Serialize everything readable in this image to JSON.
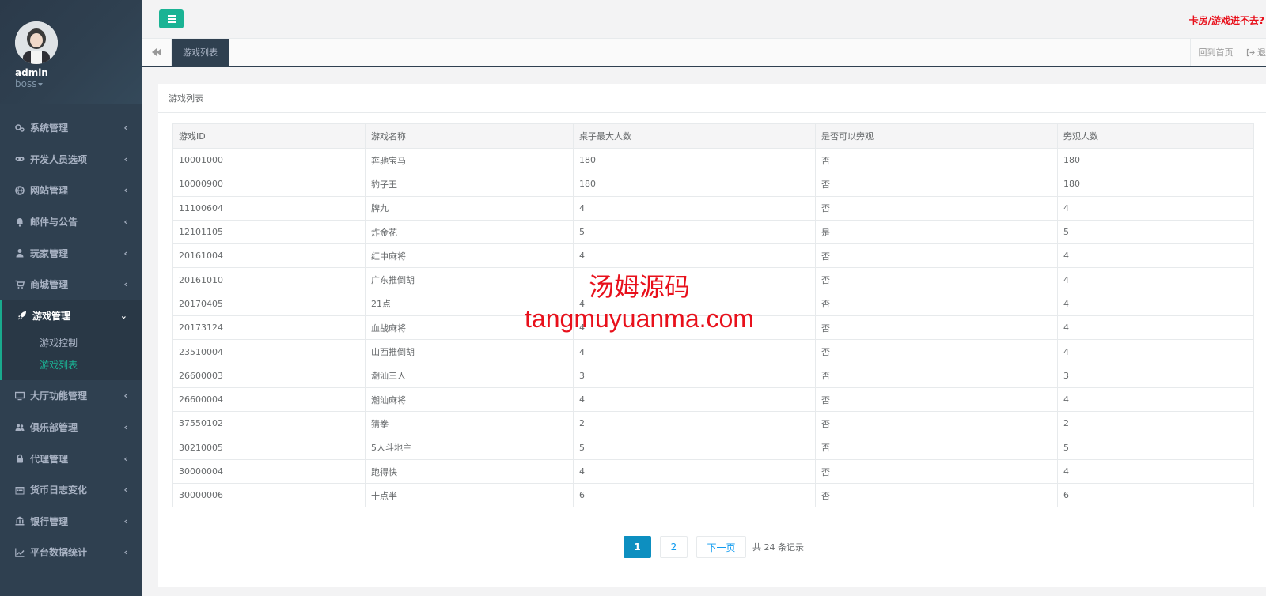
{
  "colors": {
    "sidebar_bg": "#2f4050",
    "accent": "#1ab394",
    "alert": "#e8101b",
    "page_active": "#0d8fc0"
  },
  "profile": {
    "name": "admin",
    "role": "boss"
  },
  "topbar": {
    "alert_text": "卡房/游戏进不去?"
  },
  "sidebar": {
    "items": [
      {
        "label": "系统管理",
        "icon": "cogs-icon"
      },
      {
        "label": "开发人员选项",
        "icon": "gamepad-icon"
      },
      {
        "label": "网站管理",
        "icon": "globe-icon"
      },
      {
        "label": "邮件与公告",
        "icon": "bell-icon"
      },
      {
        "label": "玩家管理",
        "icon": "user-icon"
      },
      {
        "label": "商城管理",
        "icon": "cart-icon"
      }
    ],
    "active_group": {
      "label": "游戏管理",
      "icon": "rocket-icon",
      "children": [
        {
          "label": "游戏控制"
        },
        {
          "label": "游戏列表"
        }
      ]
    },
    "items_after": [
      {
        "label": "大厅功能管理",
        "icon": "desktop-icon"
      },
      {
        "label": "俱乐部管理",
        "icon": "users-icon"
      },
      {
        "label": "代理管理",
        "icon": "lock-icon"
      },
      {
        "label": "货币日志变化",
        "icon": "calendar-icon"
      },
      {
        "label": "银行管理",
        "icon": "bank-icon"
      },
      {
        "label": "平台数据统计",
        "icon": "line-chart-icon"
      }
    ]
  },
  "tabs": {
    "active": "游戏列表",
    "home": "回到首页",
    "exit": "退出"
  },
  "panel": {
    "title": "游戏列表"
  },
  "table": {
    "headers": [
      "游戏ID",
      "游戏名称",
      "桌子最大人数",
      "是否可以旁观",
      "旁观人数"
    ],
    "rows": [
      [
        "10001000",
        "奔驰宝马",
        "180",
        "否",
        "180"
      ],
      [
        "10000900",
        "豹子王",
        "180",
        "否",
        "180"
      ],
      [
        "11100604",
        "牌九",
        "4",
        "否",
        "4"
      ],
      [
        "12101105",
        "炸金花",
        "5",
        "是",
        "5"
      ],
      [
        "20161004",
        "红中麻将",
        "4",
        "否",
        "4"
      ],
      [
        "20161010",
        "广东推倒胡",
        "",
        "否",
        "4"
      ],
      [
        "20170405",
        "21点",
        "4",
        "否",
        "4"
      ],
      [
        "20173124",
        "血战麻将",
        "4",
        "否",
        "4"
      ],
      [
        "23510004",
        "山西推倒胡",
        "4",
        "否",
        "4"
      ],
      [
        "26600003",
        "潮汕三人",
        "3",
        "否",
        "3"
      ],
      [
        "26600004",
        "潮汕麻将",
        "4",
        "否",
        "4"
      ],
      [
        "37550102",
        "猜拳",
        "2",
        "否",
        "2"
      ],
      [
        "30210005",
        "5人斗地主",
        "5",
        "否",
        "5"
      ],
      [
        "30000004",
        "跑得快",
        "4",
        "否",
        "4"
      ],
      [
        "30000006",
        "十点半",
        "6",
        "否",
        "6"
      ]
    ]
  },
  "pagination": {
    "pages": [
      "1",
      "2"
    ],
    "current": "1",
    "next": "下一页",
    "total": "共 24 条记录"
  },
  "watermark": {
    "cn": "汤姆源码",
    "en": "tangmuyuanma.com"
  }
}
